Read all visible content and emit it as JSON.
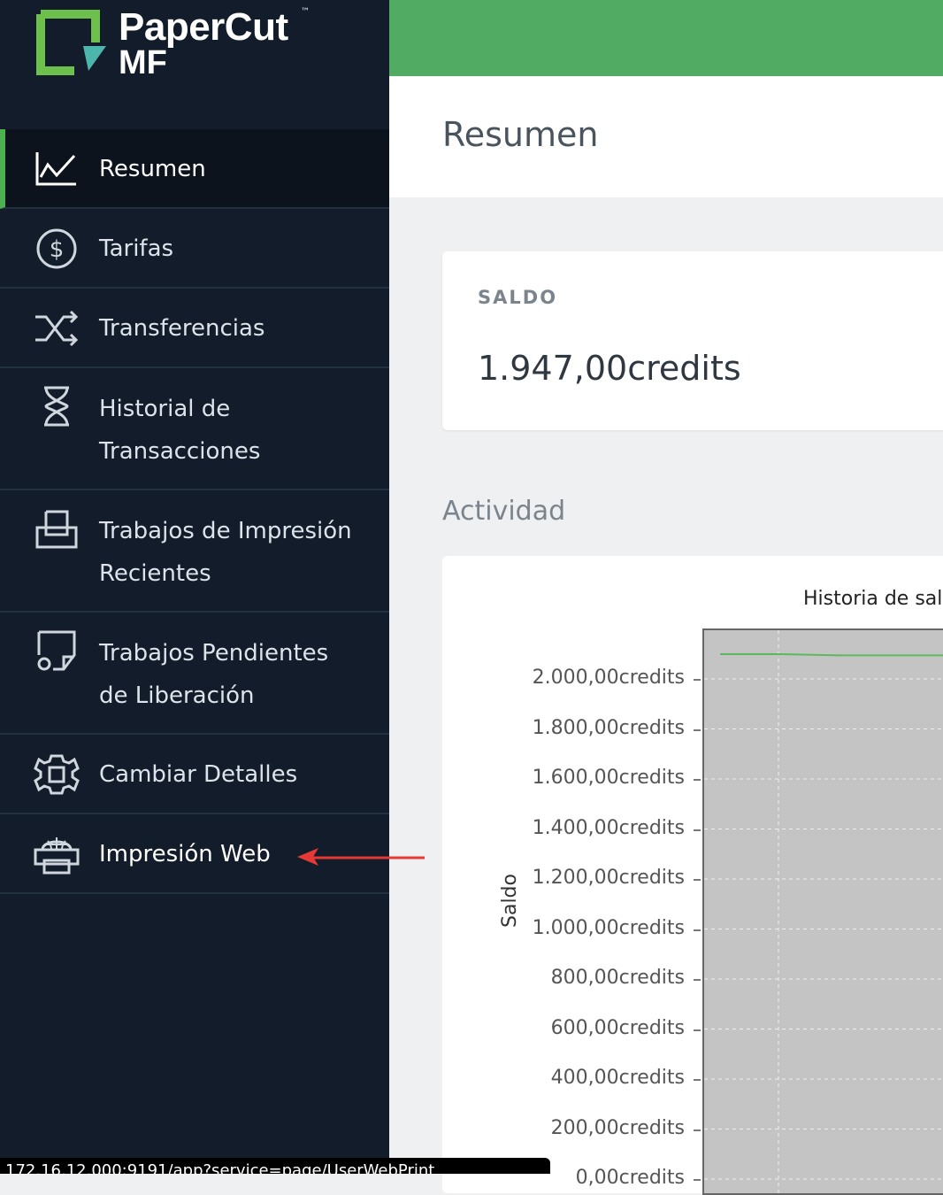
{
  "logo": {
    "top": "PaperCut",
    "bottom": "MF",
    "tm": "™"
  },
  "sidebar": {
    "items": [
      {
        "label": "Resumen",
        "icon": "chart-line-icon",
        "active": true
      },
      {
        "label": "Tarifas",
        "icon": "dollar-circle-icon"
      },
      {
        "label": "Transferencias",
        "icon": "shuffle-icon"
      },
      {
        "label_line1": "Historial de",
        "label_line2": "Transacciones",
        "icon": "hourglass-icon"
      },
      {
        "label_line1": "Trabajos de Impresión",
        "label_line2": "Recientes",
        "icon": "printer-tray-icon"
      },
      {
        "label_line1": "Trabajos Pendientes",
        "label_line2": "de Liberación",
        "icon": "pending-job-icon"
      },
      {
        "label": "Cambiar Detalles",
        "icon": "gear-icon"
      },
      {
        "label": "Impresión Web",
        "icon": "web-printer-icon"
      }
    ]
  },
  "header": {
    "title": "Resumen"
  },
  "balance": {
    "label": "SALDO",
    "value": "1.947,00credits"
  },
  "activity": {
    "title": "Actividad"
  },
  "chart_data": {
    "type": "line",
    "title": "Historia de sal",
    "ylabel": "Saldo",
    "yticks": [
      "2.000,00credits",
      "1.800,00credits",
      "1.600,00credits",
      "1.400,00credits",
      "1.200,00credits",
      "1.000,00credits",
      "800,00credits",
      "600,00credits",
      "400,00credits",
      "200,00credits",
      "0,00credits"
    ],
    "ylim": [
      0,
      2100
    ],
    "series": [
      {
        "values": [
          2000,
          2000,
          1995,
          1995,
          1995
        ]
      }
    ],
    "grid": true
  },
  "statusbar": {
    "text": "172.16.12.000:9191/app?service=page/UserWebPrint"
  },
  "colors": {
    "sidebar": "#131c2a",
    "accent": "#4caf50",
    "topbar": "#52ab62",
    "arrow": "#e53935"
  }
}
